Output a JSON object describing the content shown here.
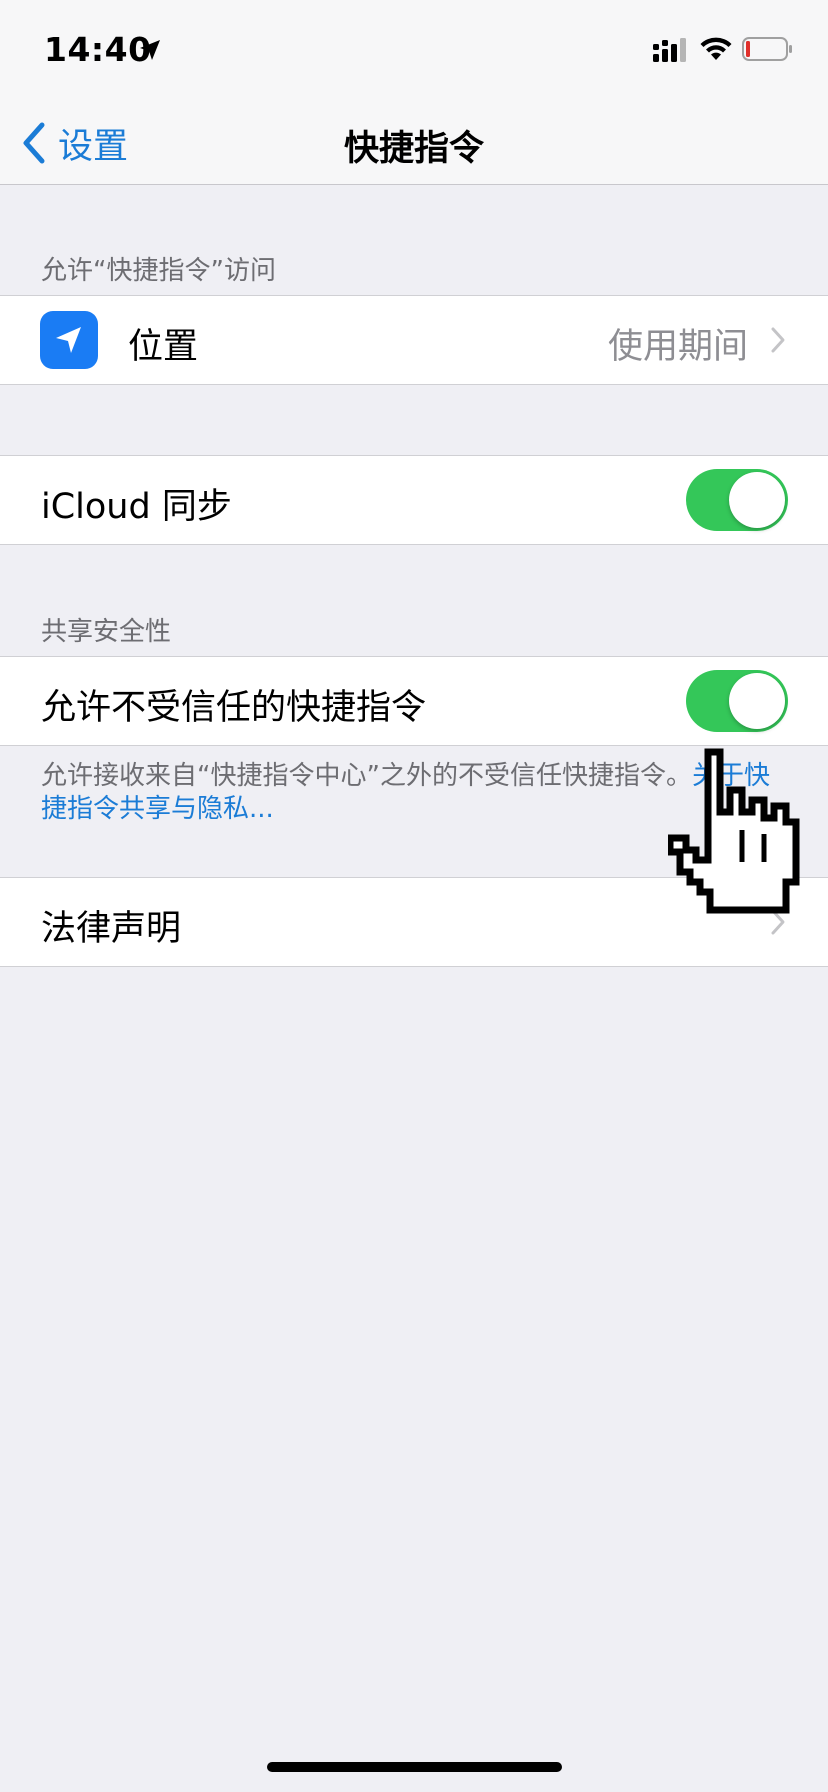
{
  "status_bar": {
    "time": "14:40",
    "icons": [
      "location-arrow-icon",
      "cellular-signal-icon",
      "wifi-icon",
      "battery-low-icon"
    ]
  },
  "nav": {
    "back_label": "设置",
    "title": "快捷指令"
  },
  "sections": {
    "access_header": "允许“快捷指令”访问",
    "location": {
      "label": "位置",
      "value": "使用期间",
      "icon": "location-arrow-icon"
    },
    "icloud_sync": {
      "label": "iCloud 同步",
      "enabled": true
    },
    "sharing_header": "共享安全性",
    "untrusted": {
      "label": "允许不受信任的快捷指令",
      "enabled": true
    },
    "footer": {
      "text": "允许接收来自“快捷指令中心”之外的不受信任快捷指令。",
      "link": "关于快捷指令共享与隐私..."
    },
    "legal": {
      "label": "法律声明"
    }
  },
  "colors": {
    "accent": "#1b7cd6",
    "toggle_on": "#34c759",
    "app_icon": "#1a7cf4",
    "background": "#efeff4",
    "battery_low": "#e0302b"
  }
}
